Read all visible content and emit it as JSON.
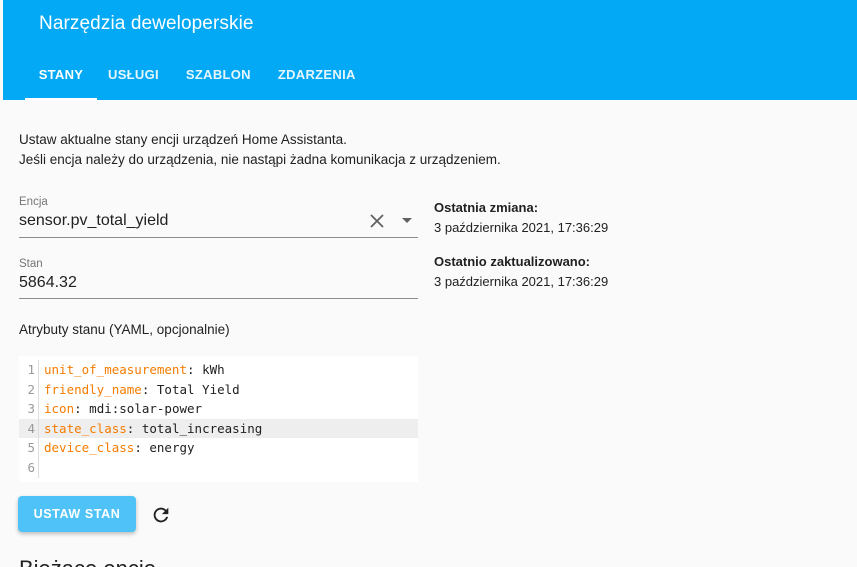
{
  "header": {
    "title": "Narzędzia deweloperskie",
    "tabs": [
      {
        "label": "STANY",
        "active": true
      },
      {
        "label": "USŁUGI",
        "active": false
      },
      {
        "label": "SZABLON",
        "active": false
      },
      {
        "label": "ZDARZENIA",
        "active": false
      }
    ]
  },
  "intro": {
    "line1": "Ustaw aktualne stany encji urządzeń Home Assistanta.",
    "line2": "Jeśli encja należy do urządzenia, nie nastąpi żadna komunikacja z urządzeniem."
  },
  "entity": {
    "label": "Encja",
    "value": "sensor.pv_total_yield"
  },
  "state": {
    "label": "Stan",
    "value": "5864.32"
  },
  "info": {
    "last_changed_label": "Ostatnia zmiana:",
    "last_changed_value": "3 października 2021, 17:36:29",
    "last_updated_label": "Ostatnio zaktualizowano:",
    "last_updated_value": "3 października 2021, 17:36:29"
  },
  "attributes": {
    "label": "Atrybuty stanu (YAML, opcjonalnie)",
    "lines": [
      {
        "num": "1",
        "key": "unit_of_measurement",
        "sep": ": ",
        "value": "kWh"
      },
      {
        "num": "2",
        "key": "friendly_name",
        "sep": ": ",
        "value": "Total Yield"
      },
      {
        "num": "3",
        "key": "icon",
        "sep": ": ",
        "value": "mdi:solar-power"
      },
      {
        "num": "4",
        "key": "state_class",
        "sep": ": ",
        "value": "total_increasing"
      },
      {
        "num": "5",
        "key": "device_class",
        "sep": ": ",
        "value": "energy"
      },
      {
        "num": "6",
        "key": "",
        "sep": "",
        "value": ""
      }
    ]
  },
  "actions": {
    "set_state_label": "USTAW STAN"
  },
  "current_entities_heading": "Bieżące encje",
  "colors": {
    "header": "#03a9f4",
    "button": "#4fc3f7",
    "yaml_key": "#f57c00"
  }
}
